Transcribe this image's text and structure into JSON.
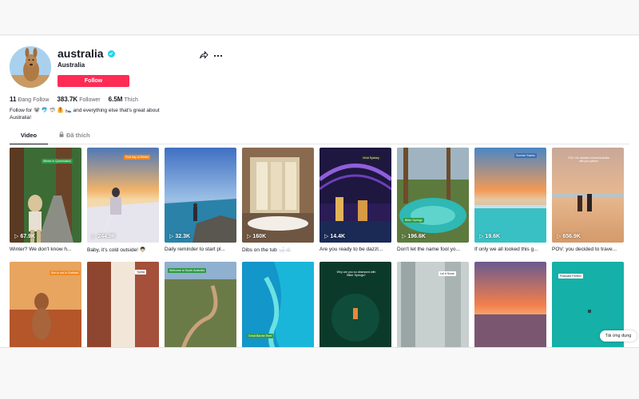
{
  "profile": {
    "username": "australia",
    "nickname": "Australia",
    "follow_label": "Follow",
    "bio_line1": "Follow for 🐨 🐬 🦈 🦺 🛌 and everything else that's great about",
    "bio_line2": "Australia!"
  },
  "stats": [
    {
      "value": "11",
      "label": "Đang Follow"
    },
    {
      "value": "383.7K",
      "label": "Follower"
    },
    {
      "value": "6.5M",
      "label": "Thích"
    }
  ],
  "tabs": {
    "video": "Video",
    "liked": "Đã thích"
  },
  "videos": [
    {
      "views": "67.9K",
      "caption": "Winter? We don't know h...",
      "tag": "Winter in Queensland",
      "tag_color": "#2e9a46"
    },
    {
      "views": "244.9K",
      "caption": "Baby, it's cold outside! 👨🏻",
      "tag": "First day of Winter",
      "tag_color": "#f08a24"
    },
    {
      "views": "32.3K",
      "caption": "Daily reminder to start pl...",
      "tag": "",
      "tag_color": ""
    },
    {
      "views": "160K",
      "caption": "Dibs on the tub 🛁☁️",
      "tag": "",
      "tag_color": ""
    },
    {
      "views": "14.4K",
      "caption": "Are you ready to be dazzl...",
      "tag": "Vivid Sydney",
      "tag_color": "#222222"
    },
    {
      "views": "196.6K",
      "caption": "Don't let the name fool yo...",
      "tag": "Bitter Springs",
      "tag_color": "#2e9a46"
    },
    {
      "views": "19.6K",
      "caption": "If only we all looked this g...",
      "tag": "Sunrise Swims",
      "tag_color": "#3b6fb0"
    },
    {
      "views": "656.9K",
      "caption": "POV: you decided to trave...",
      "tag": "POV: You decided to travel Australia with your partner",
      "tag_color": "transparent"
    },
    {
      "views": "",
      "caption": "",
      "tag": "Sun is out in Outback",
      "tag_color": "#f08a24"
    },
    {
      "views": "",
      "caption": "",
      "tag": "Tjorita",
      "tag_color": "#ffffff"
    },
    {
      "views": "",
      "caption": "",
      "tag": "Welcome to South Australia",
      "tag_color": "#2e9a46"
    },
    {
      "views": "",
      "caption": "",
      "tag": "Great Barrier Reef",
      "tag_color": "#2e9a46"
    },
    {
      "views": "",
      "caption": "",
      "tag": "Why are you so obsessed with Bitter Springs?",
      "tag_color": "transparent"
    },
    {
      "views": "",
      "caption": "",
      "tag": "Let it Snow",
      "tag_color": "#ffffff"
    },
    {
      "views": "",
      "caption": "",
      "tag": "",
      "tag_color": ""
    },
    {
      "views": "",
      "caption": "",
      "tag": "Postcard Perfect",
      "tag_color": "#ffffff"
    }
  ],
  "app_button": "Tải ứng dụng",
  "colors": {
    "accent": "#fe2c55",
    "verified": "#20d5ec"
  }
}
